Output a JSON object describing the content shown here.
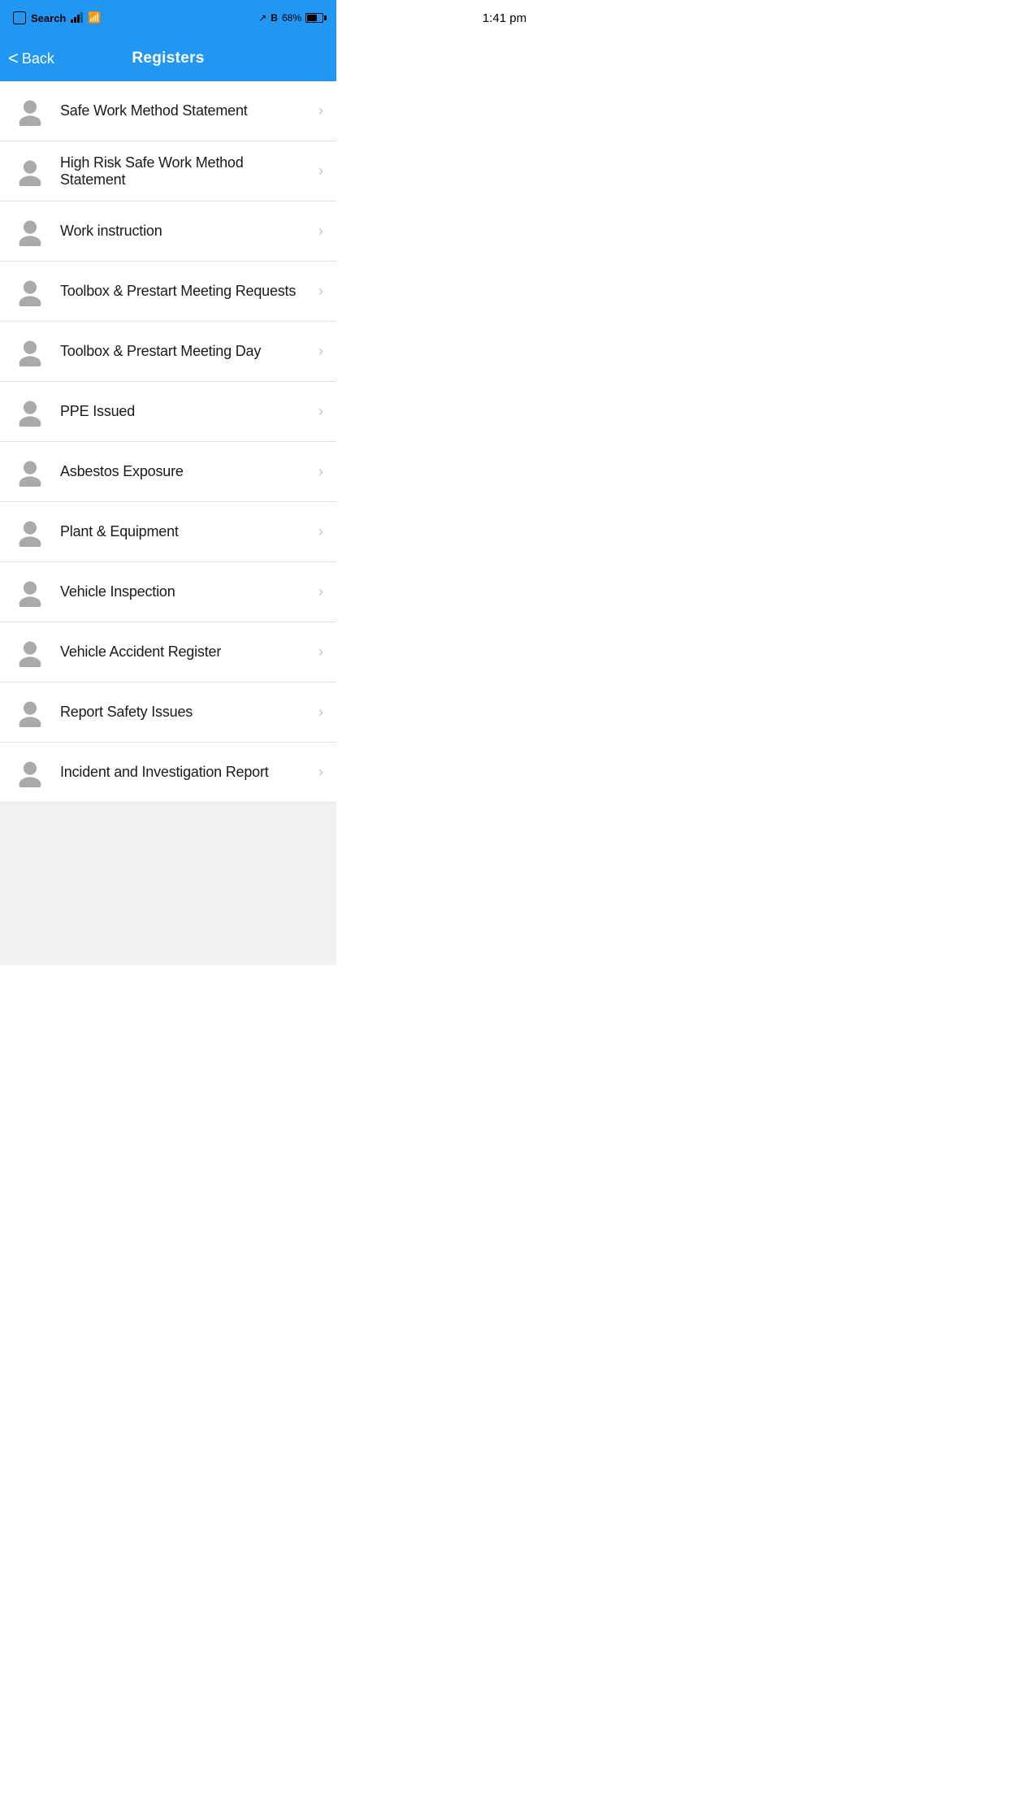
{
  "statusBar": {
    "carrier": "Search",
    "time": "1:41 pm",
    "battery": "68%",
    "batteryLevel": 68
  },
  "navBar": {
    "title": "Registers",
    "backLabel": "Back"
  },
  "listItems": [
    {
      "id": 1,
      "label": "Safe Work Method Statement"
    },
    {
      "id": 2,
      "label": "High Risk Safe Work Method Statement"
    },
    {
      "id": 3,
      "label": "Work instruction"
    },
    {
      "id": 4,
      "label": "Toolbox & Prestart Meeting Requests"
    },
    {
      "id": 5,
      "label": "Toolbox & Prestart Meeting Day"
    },
    {
      "id": 6,
      "label": "PPE Issued"
    },
    {
      "id": 7,
      "label": "Asbestos Exposure"
    },
    {
      "id": 8,
      "label": "Plant & Equipment"
    },
    {
      "id": 9,
      "label": "Vehicle Inspection"
    },
    {
      "id": 10,
      "label": "Vehicle Accident Register"
    },
    {
      "id": 11,
      "label": "Report Safety Issues"
    },
    {
      "id": 12,
      "label": "Incident and Investigation Report"
    }
  ],
  "icons": {
    "back": "‹",
    "chevronRight": "›",
    "personIconColor": "#aaaaaa"
  },
  "colors": {
    "headerBg": "#2196F3",
    "headerText": "#ffffff",
    "listBg": "#ffffff",
    "divider": "#e0e0e0",
    "itemText": "#1a1a1a",
    "chevron": "#c0c0c0"
  }
}
